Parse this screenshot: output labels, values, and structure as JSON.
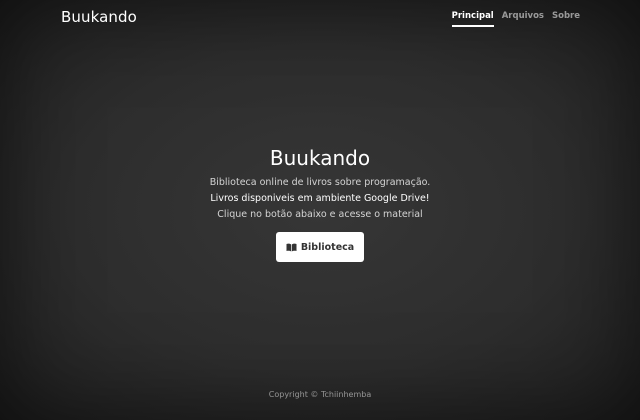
{
  "header": {
    "brand": "Buukando",
    "nav": [
      {
        "label": "Principal",
        "active": true
      },
      {
        "label": "Arquivos",
        "active": false
      },
      {
        "label": "Sobre",
        "active": false
      }
    ]
  },
  "main": {
    "title": "Buukando",
    "line1": "Biblioteca online de livros sobre programação.",
    "line2": "Livros disponiveis em ambiente Google Drive!",
    "line3": "Clique no botão abaixo e acesse o material",
    "button": {
      "icon": "book-open-icon",
      "label": "Biblioteca"
    }
  },
  "footer": {
    "copyright": "Copyright © Tchiinhemba"
  },
  "colors": {
    "background": "#333333",
    "text": "#ffffff",
    "button_bg": "#ffffff",
    "button_text": "#333333"
  }
}
